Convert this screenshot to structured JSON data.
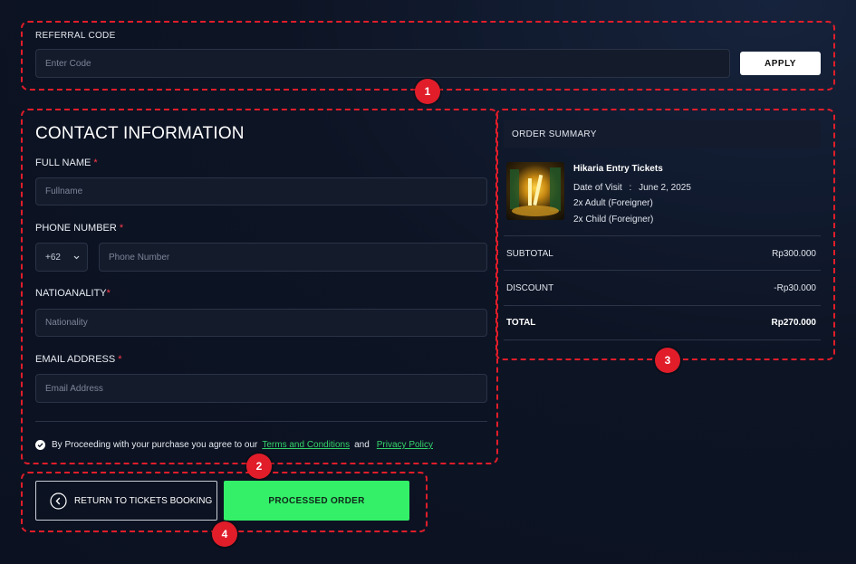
{
  "referral": {
    "label": "REFERRAL CODE",
    "placeholder": "Enter Code",
    "apply_label": "APPLY",
    "marker": "1"
  },
  "contact": {
    "title": "CONTACT INFORMATION",
    "full_name_label": "FULL NAME",
    "full_name_placeholder": "Fullname",
    "phone_label": "PHONE NUMBER",
    "phone_code": "+62",
    "phone_placeholder": "Phone Number",
    "nationality_label": "NATIOANALITY",
    "nationality_placeholder": "Nationality",
    "email_label": "EMAIL ADDRESS",
    "email_placeholder": "Email Address",
    "required_mark": "*",
    "agree_prefix": "By Proceeding with your purchase you agree to our",
    "terms_label": "Terms and Conditions",
    "and_text": "and",
    "privacy_label": "Privacy Policy",
    "marker": "2"
  },
  "summary": {
    "title": "ORDER SUMMARY",
    "ticket_name": "Hikaria Entry Tickets",
    "date_label": "Date of Visit",
    "date_sep": ":",
    "date_value": "June 2, 2025",
    "line1": "2x Adult (Foreigner)",
    "line2": "2x Child (Foreigner)",
    "subtotal_label": "SUBTOTAL",
    "subtotal_value": "Rp300.000",
    "discount_label": "DISCOUNT",
    "discount_value": "-Rp30.000",
    "total_label": "TOTAL",
    "total_value": "Rp270.000",
    "marker": "3"
  },
  "actions": {
    "return_label": "RETURN TO TICKETS BOOKING",
    "process_label": "PROCESSED ORDER",
    "marker": "4"
  },
  "colors": {
    "annotation": "#e11d2a",
    "accent_green": "#33f068",
    "link_green": "#34d36b"
  }
}
